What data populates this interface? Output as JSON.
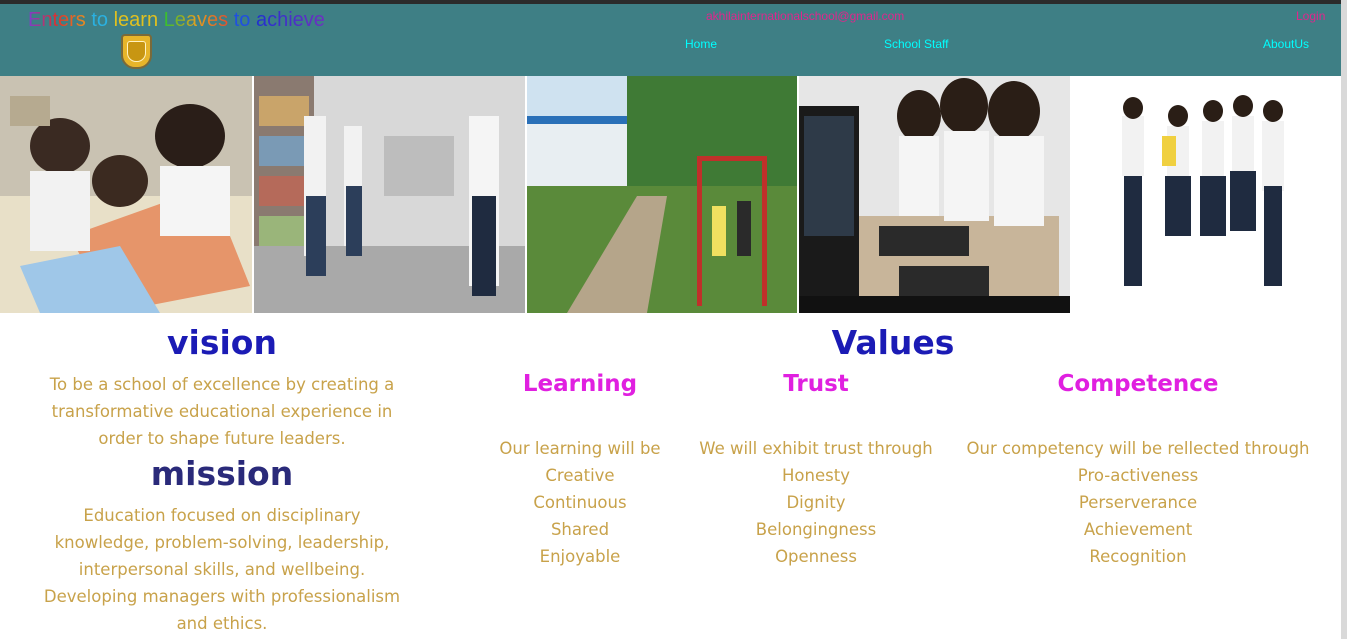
{
  "header": {
    "tagline_words": [
      {
        "text": "Enters",
        "color": "multi"
      },
      {
        "text": " to ",
        "color": "#2bb0e0"
      },
      {
        "text": "learn",
        "color": "#e0c020"
      },
      {
        "text": " ",
        "color": "#000000"
      },
      {
        "text": "Leaves",
        "color": "multi"
      },
      {
        "text": " to ",
        "color": "#2050e0"
      },
      {
        "text": "achieve",
        "color": "multi"
      }
    ],
    "email": "akhilainternationalschool@gmail.com",
    "login_label": "Login",
    "nav": {
      "home": "Home",
      "staff": "School Staff",
      "about": "AboutUs"
    }
  },
  "colors": {
    "header_bg": "#3e7f85",
    "nav_link": "#00ffff",
    "email_login": "#e0268c",
    "heading": "#1b1bb5",
    "value_title": "#e020e0",
    "body_text": "#c8a24a"
  },
  "photos": [
    {
      "name": "students-drawing-photo"
    },
    {
      "name": "library-students-photo"
    },
    {
      "name": "school-garden-swings-photo"
    },
    {
      "name": "computer-lab-students-photo"
    },
    {
      "name": "jumping-students-photo"
    }
  ],
  "vision": {
    "title": "vision",
    "text": "To be a school of excellence by creating a transformative educational experience in order to shape future leaders."
  },
  "mission": {
    "title": "mission",
    "text": "Education focused on disciplinary knowledge, problem-solving, leadership, interpersonal skills, and wellbeing. Developing managers with professionalism and ethics."
  },
  "values": {
    "title": "Values",
    "learning": {
      "title": "Learning",
      "items": [
        "Our learning will be",
        "Creative",
        "Continuous",
        "Shared",
        "Enjoyable"
      ]
    },
    "trust": {
      "title": "Trust",
      "items": [
        "We will exhibit trust through",
        "Honesty",
        "Dignity",
        "Belongingness",
        "Openness"
      ]
    },
    "competence": {
      "title": "Competence",
      "items": [
        "Our competency will be rellected through",
        "Pro-activeness",
        "Perserverance",
        "Achievement",
        "Recognition"
      ]
    }
  }
}
